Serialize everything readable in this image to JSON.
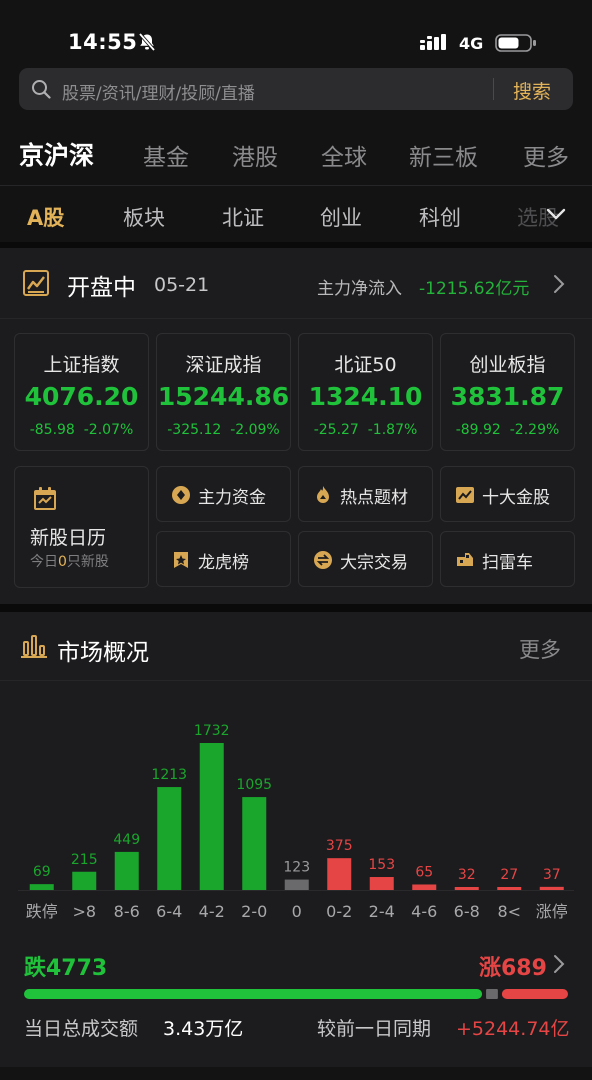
{
  "status_bar": {
    "time": "14:55",
    "network": "4G"
  },
  "search": {
    "placeholder": "股票/资讯/理财/投顾/直播",
    "button": "搜索"
  },
  "market_tabs": [
    "京沪深",
    "基金",
    "港股",
    "全球",
    "新三板",
    "更多"
  ],
  "sub_tabs": [
    "A股",
    "板块",
    "北证",
    "创业",
    "科创",
    "选股"
  ],
  "session": {
    "status": "开盘中",
    "date": "05-21",
    "main_flow_label": "主力净流入",
    "main_flow_value": "-1215.62亿元"
  },
  "indices": [
    {
      "name": "上证指数",
      "value": "4076.20",
      "change": "-85.98",
      "pct": "-2.07%"
    },
    {
      "name": "深证成指",
      "value": "15244.86",
      "change": "-325.12",
      "pct": "-2.09%"
    },
    {
      "name": "北证50",
      "value": "1324.10",
      "change": "-25.27",
      "pct": "-1.87%"
    },
    {
      "name": "创业板指",
      "value": "3831.87",
      "change": "-89.92",
      "pct": "-2.29%"
    }
  ],
  "ipo": {
    "title": "新股日历",
    "prefix": "今日",
    "count": "0",
    "suffix": "只新股"
  },
  "tools": [
    {
      "label": "主力资金",
      "icon": "capital-flow-icon"
    },
    {
      "label": "热点题材",
      "icon": "hot-topic-icon"
    },
    {
      "label": "十大金股",
      "icon": "top-stocks-icon"
    },
    {
      "label": "龙虎榜",
      "icon": "dragon-tiger-icon"
    },
    {
      "label": "大宗交易",
      "icon": "block-trade-icon"
    },
    {
      "label": "扫雷车",
      "icon": "risk-scan-icon"
    }
  ],
  "overview": {
    "title": "市场概况",
    "more": "更多"
  },
  "chart_data": {
    "type": "bar",
    "title": "",
    "categories": [
      "跌停",
      ">8",
      "8-6",
      "6-4",
      "4-2",
      "2-0",
      "0",
      "0-2",
      "2-4",
      "4-6",
      "6-8",
      "8<",
      "涨停"
    ],
    "values": [
      69,
      215,
      449,
      1213,
      1732,
      1095,
      123,
      375,
      153,
      65,
      32,
      27,
      37
    ],
    "colors": [
      "#1aa52c",
      "#1aa52c",
      "#1aa52c",
      "#1aa52c",
      "#1aa52c",
      "#1aa52c",
      "#6a6a6c",
      "#e54545",
      "#e54545",
      "#e54545",
      "#e54545",
      "#e54545",
      "#e54545"
    ],
    "ylim": [
      0,
      1732
    ],
    "grid": false,
    "legend": "none"
  },
  "breadth": {
    "fall_label": "跌4773",
    "rise_label": "涨689",
    "fall": 4773,
    "flat": 123,
    "rise": 689
  },
  "turnover": {
    "label": "当日总成交额",
    "value": "3.43万亿",
    "compare_label": "较前一日同期",
    "compare_value": "+5244.74亿"
  },
  "colors": {
    "accent": "#e3b35a",
    "down": "#1fc23a",
    "up": "#e54545",
    "flat": "#6a6a6c"
  }
}
